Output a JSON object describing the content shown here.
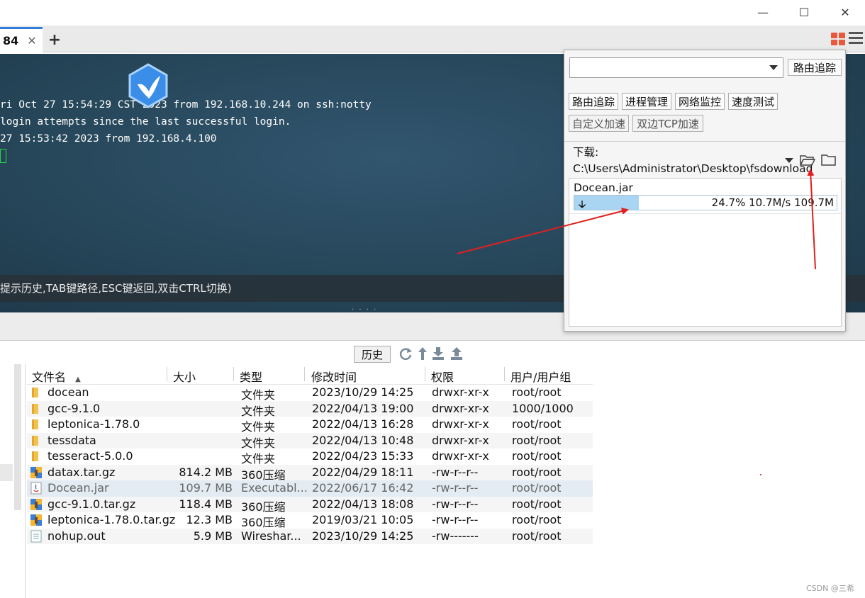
{
  "window": {
    "minimize_glyph": "—",
    "maximize_glyph": "☐",
    "close_glyph": "✕"
  },
  "tabs": [
    {
      "label": "84",
      "close_glyph": "✕"
    }
  ],
  "new_tab_glyph": "+",
  "terminal": {
    "lines": [
      "ri Oct 27 15:54:29 CST 2023 from 192.168.10.244 on ssh:notty",
      "login attempts since the last successful login.",
      "27 15:53:42 2023 from 192.168.4.100"
    ],
    "status_hint": "提示历史,TAB键路径,ESC键返回,双击CTRL切换)"
  },
  "splitter_dots": "· · · ·",
  "popup": {
    "search_placeholder": "",
    "route_button": "路由追踪",
    "tools": [
      "路由追踪",
      "进程管理",
      "网络监控",
      "速度测试"
    ],
    "tools2": [
      "自定义加速",
      "双边TCP加速"
    ],
    "download_label": "下载: C:\\Users\\Administrator\\Desktop\\fsdownload",
    "download": {
      "file": "Docean.jar",
      "arrow": "🡣",
      "percent": "24.7%",
      "speed": "10.7M/s",
      "size": "109.7M",
      "progress_fraction": 0.247
    }
  },
  "file_toolbar": {
    "history_label": "历史"
  },
  "table": {
    "headers": {
      "name": "文件名",
      "size": "大小",
      "type": "类型",
      "time": "修改时间",
      "perm": "权限",
      "owner": "用户/用户组"
    },
    "sort_glyph": "▲",
    "rows": [
      {
        "icon": "folder-icon",
        "name": "docean",
        "size": "",
        "type": "文件夹",
        "time": "2023/10/29 14:25",
        "perm": "drwxr-xr-x",
        "owner": "root/root"
      },
      {
        "icon": "folder-icon",
        "name": "gcc-9.1.0",
        "size": "",
        "type": "文件夹",
        "time": "2022/04/13 19:00",
        "perm": "drwxr-xr-x",
        "owner": "1000/1000"
      },
      {
        "icon": "folder-icon",
        "name": "leptonica-1.78.0",
        "size": "",
        "type": "文件夹",
        "time": "2022/04/13 16:28",
        "perm": "drwxr-xr-x",
        "owner": "root/root"
      },
      {
        "icon": "folder-icon",
        "name": "tessdata",
        "size": "",
        "type": "文件夹",
        "time": "2022/04/13 10:48",
        "perm": "drwxr-xr-x",
        "owner": "root/root"
      },
      {
        "icon": "folder-icon",
        "name": "tesseract-5.0.0",
        "size": "",
        "type": "文件夹",
        "time": "2022/04/23 15:33",
        "perm": "drwxr-xr-x",
        "owner": "root/root"
      },
      {
        "icon": "archive-icon",
        "name": "datax.tar.gz",
        "size": "814.2 MB",
        "type": "360压缩",
        "time": "2022/04/29 18:11",
        "perm": "-rw-r--r--",
        "owner": "root/root"
      },
      {
        "icon": "java-file-icon",
        "name": "Docean.jar",
        "size": "109.7 MB",
        "type": "Executabl...",
        "time": "2022/06/17 16:42",
        "perm": "-rw-r--r--",
        "owner": "root/root"
      },
      {
        "icon": "archive-icon",
        "name": "gcc-9.1.0.tar.gz",
        "size": "118.4 MB",
        "type": "360压缩",
        "time": "2022/04/13 18:08",
        "perm": "-rw-r--r--",
        "owner": "root/root"
      },
      {
        "icon": "archive-icon",
        "name": "leptonica-1.78.0.tar.gz",
        "size": "12.3 MB",
        "type": "360压缩",
        "time": "2019/03/21 10:05",
        "perm": "-rw-r--r--",
        "owner": "root/root"
      },
      {
        "icon": "text-file-icon",
        "name": "nohup.out",
        "size": "5.9 MB",
        "type": "Wireshar...",
        "time": "2023/10/29 14:25",
        "perm": "-rw-------",
        "owner": "root/root"
      }
    ]
  },
  "watermark": "CSDN @三希",
  "colors": {
    "accent": "#2f7ed8",
    "annotation": "#e02020",
    "progress": "#a9d5f2",
    "terminal_bg": "#264659"
  }
}
